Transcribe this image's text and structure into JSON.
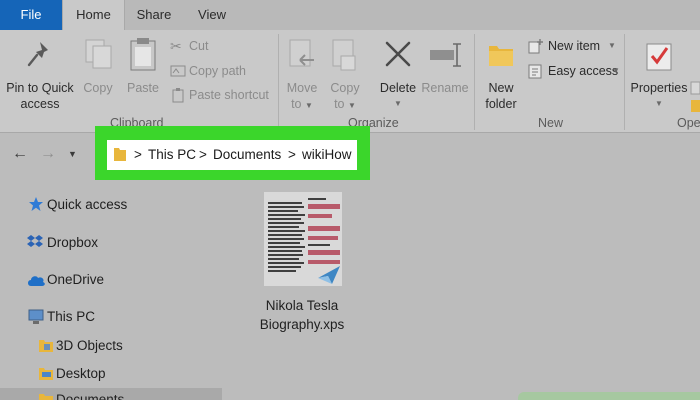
{
  "tabs": [
    {
      "label": "File"
    },
    {
      "label": "Home"
    },
    {
      "label": "Share"
    },
    {
      "label": "View"
    }
  ],
  "ribbon": {
    "clipboard": {
      "pin_line1": "Pin to Quick",
      "pin_line2": "access",
      "copy": "Copy",
      "paste": "Paste",
      "cut": "Cut",
      "copy_path": "Copy path",
      "paste_shortcut": "Paste shortcut",
      "label": "Clipboard"
    },
    "organize": {
      "move_line1": "Move",
      "move_line2": "to",
      "copy_line1": "Copy",
      "copy_line2": "to",
      "delete": "Delete",
      "rename": "Rename",
      "label": "Organize"
    },
    "new": {
      "new_folder_line1": "New",
      "new_folder_line2": "folder",
      "new_item": "New item",
      "easy_access": "Easy access",
      "label": "New"
    },
    "open": {
      "properties": "Properties",
      "label": "Ope"
    }
  },
  "address": {
    "crumbs": [
      "This PC",
      "Documents",
      "wikiHow"
    ]
  },
  "nav_pane": {
    "items": [
      {
        "label": "Quick access",
        "icon": "star-icon"
      },
      {
        "label": "Dropbox",
        "icon": "dropbox-icon"
      },
      {
        "label": "OneDrive",
        "icon": "cloud-icon"
      },
      {
        "label": "This PC",
        "icon": "computer-icon"
      },
      {
        "label": "3D Objects",
        "icon": "folder-icon"
      },
      {
        "label": "Desktop",
        "icon": "folder-icon"
      },
      {
        "label": "Documents",
        "icon": "folder-icon"
      }
    ]
  },
  "files": [
    {
      "line1": "Nikola Tesla",
      "line2": "Biography.xps"
    }
  ],
  "colors": {
    "file_tab": "#1565b8",
    "highlight": "#3bd62b",
    "folder": "#e8b63c"
  }
}
